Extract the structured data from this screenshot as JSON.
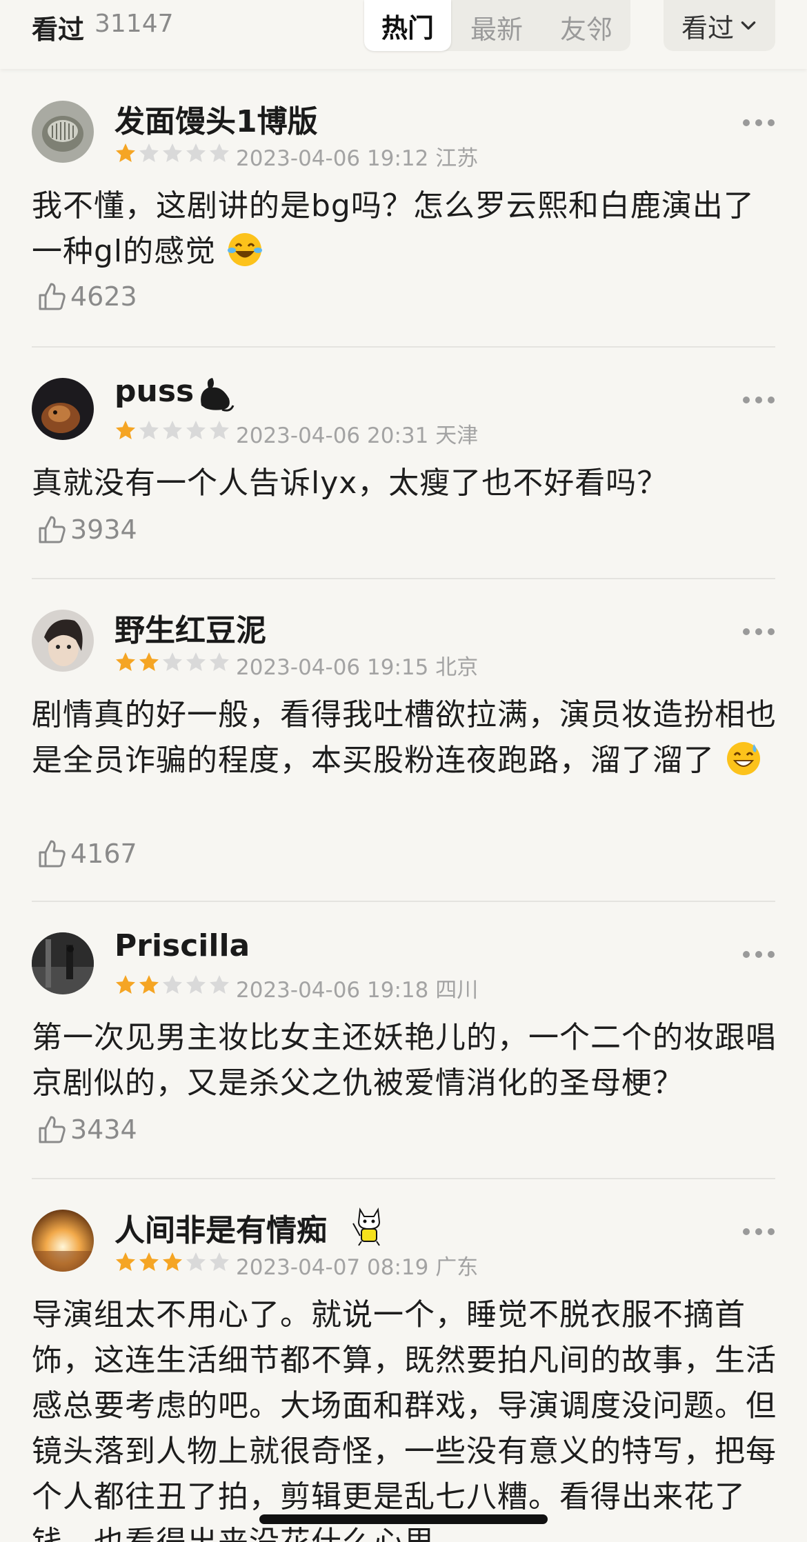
{
  "header": {
    "count_label": "看过",
    "count_value": "31147",
    "tabs": [
      {
        "label": "热门",
        "active": true
      },
      {
        "label": "最新",
        "active": false
      },
      {
        "label": "友邻",
        "active": false
      }
    ],
    "filter_label": "看过"
  },
  "colors": {
    "background": "#f7f6f2",
    "star_on": "#f5a524",
    "star_off": "#d9d9d9",
    "meta_text": "#a3a3a3"
  },
  "comments": [
    {
      "username": "发面馒头1博版",
      "rating": 1,
      "date": "2023-04-06 19:12",
      "location": "江苏",
      "text": "我不懂，这剧讲的是bg吗？怎么罗云熙和白鹿演出了一种gl的感觉",
      "emoji": "laughing-tears-emoji",
      "likes": "4623"
    },
    {
      "username": "puss",
      "rating": 1,
      "date": "2023-04-06 20:31",
      "location": "天津",
      "text": "真就没有一个人告诉lyx，太瘦了也不好看吗？",
      "badge": "rooster-badge-icon",
      "likes": "3934"
    },
    {
      "username": "野生红豆泥",
      "rating": 2,
      "date": "2023-04-06 19:15",
      "location": "北京",
      "text": "剧情真的好一般，看得我吐槽欲拉满，演员妆造扮相也是全员诈骗的程度，本买股粉连夜跑路，溜了溜了",
      "emoji": "sweat-smile-emoji",
      "likes": "4167"
    },
    {
      "username": "Priscilla",
      "rating": 2,
      "date": "2023-04-06 19:18",
      "location": "四川",
      "text": "第一次见男主妆比女主还妖艳儿的，一个二个的妆跟唱京剧似的，又是杀父之仇被爱情消化的圣母梗？",
      "likes": "3434"
    },
    {
      "username": "人间非是有情痴",
      "rating": 3,
      "date": "2023-04-07 08:19",
      "location": "广东",
      "text": "导演组太不用心了。就说一个，睡觉不脱衣服不摘首饰，这连生活细节都不算，既然要拍凡间的故事，生活感总要考虑的吧。大场面和群戏，导演调度没问题。但镜头落到人物上就很奇怪，一些没有意义的特写，把每个人都往丑了拍，剪辑更是乱七八糟。看得出来花了钱，也看得出来没花什么心思",
      "badge": "cat-badge-icon"
    }
  ]
}
